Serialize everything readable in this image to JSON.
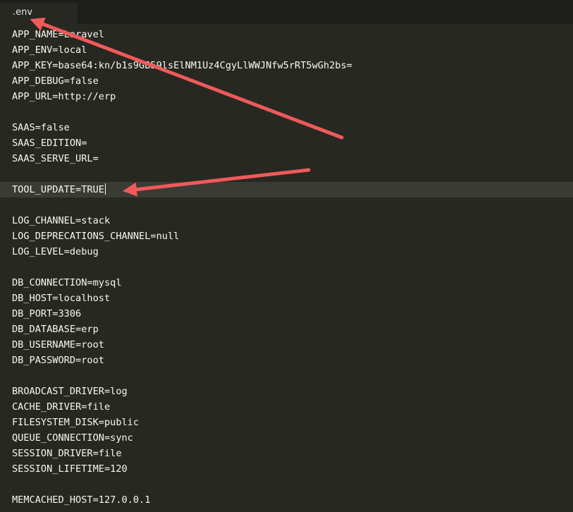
{
  "tab": {
    "label": ".env"
  },
  "lines": [
    "APP_NAME=Laravel",
    "APP_ENV=local",
    "APP_KEY=base64:kn/b1s9GB59lsElNM1Uz4CgyLlWWJNfw5rRT5wGh2bs=",
    "APP_DEBUG=false",
    "APP_URL=http://erp",
    "",
    "SAAS=false",
    "SAAS_EDITION=",
    "SAAS_SERVE_URL=",
    "",
    "TOOL_UPDATE=TRUE",
    "",
    "LOG_CHANNEL=stack",
    "LOG_DEPRECATIONS_CHANNEL=null",
    "LOG_LEVEL=debug",
    "",
    "DB_CONNECTION=mysql",
    "DB_HOST=localhost",
    "DB_PORT=3306",
    "DB_DATABASE=erp",
    "DB_USERNAME=root",
    "DB_PASSWORD=root",
    "",
    "BROADCAST_DRIVER=log",
    "CACHE_DRIVER=file",
    "FILESYSTEM_DISK=public",
    "QUEUE_CONNECTION=sync",
    "SESSION_DRIVER=file",
    "SESSION_LIFETIME=120",
    "",
    "MEMCACHED_HOST=127.0.0.1"
  ],
  "active_line_index": 10,
  "colors": {
    "editor_background": "#272822",
    "active_line": "#3a3b35",
    "text": "#f8f8f2",
    "annotation_arrow": "#f05a5a"
  }
}
